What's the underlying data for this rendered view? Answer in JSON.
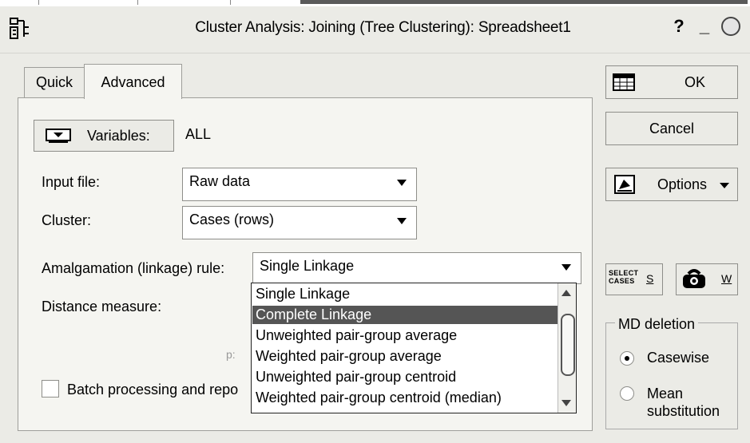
{
  "window": {
    "title": "Cluster Analysis: Joining (Tree Clustering): Spreadsheet1",
    "help_label": "?",
    "minimize_label": "_"
  },
  "tabs": [
    {
      "label": "Quick",
      "active": false
    },
    {
      "label": "Advanced",
      "active": true
    }
  ],
  "variables": {
    "button_label": "Variables:",
    "value": "ALL"
  },
  "input_file": {
    "label": "Input file:",
    "value": "Raw data"
  },
  "cluster": {
    "label": "Cluster:",
    "value": "Cases (rows)"
  },
  "amalgamation": {
    "label": "Amalgamation (linkage) rule:",
    "value": "Single Linkage",
    "options": [
      "Single Linkage",
      "Complete Linkage",
      "Unweighted pair-group average",
      "Weighted pair-group average",
      "Unweighted pair-group centroid",
      "Weighted pair-group centroid (median)"
    ],
    "highlighted_option": "Complete Linkage"
  },
  "distance": {
    "label": "Distance measure:",
    "ghost_text": "p:"
  },
  "batch": {
    "label": "Batch processing and repo",
    "checked": false
  },
  "buttons": {
    "ok": "OK",
    "cancel": "Cancel",
    "options": "Options",
    "select_cases_icon_text": "SELECT CASES",
    "select_cases_key": "S",
    "weights_key": "W"
  },
  "md_deletion": {
    "legend": "MD deletion",
    "options": [
      {
        "label": "Casewise",
        "selected": true
      },
      {
        "label": "Mean substitution",
        "selected": false
      }
    ]
  },
  "colors": {
    "dialog_bg": "#ebebe6",
    "panel_bg": "#f5f5f1",
    "selection_bg": "#555555",
    "selection_fg": "#ffffff"
  }
}
